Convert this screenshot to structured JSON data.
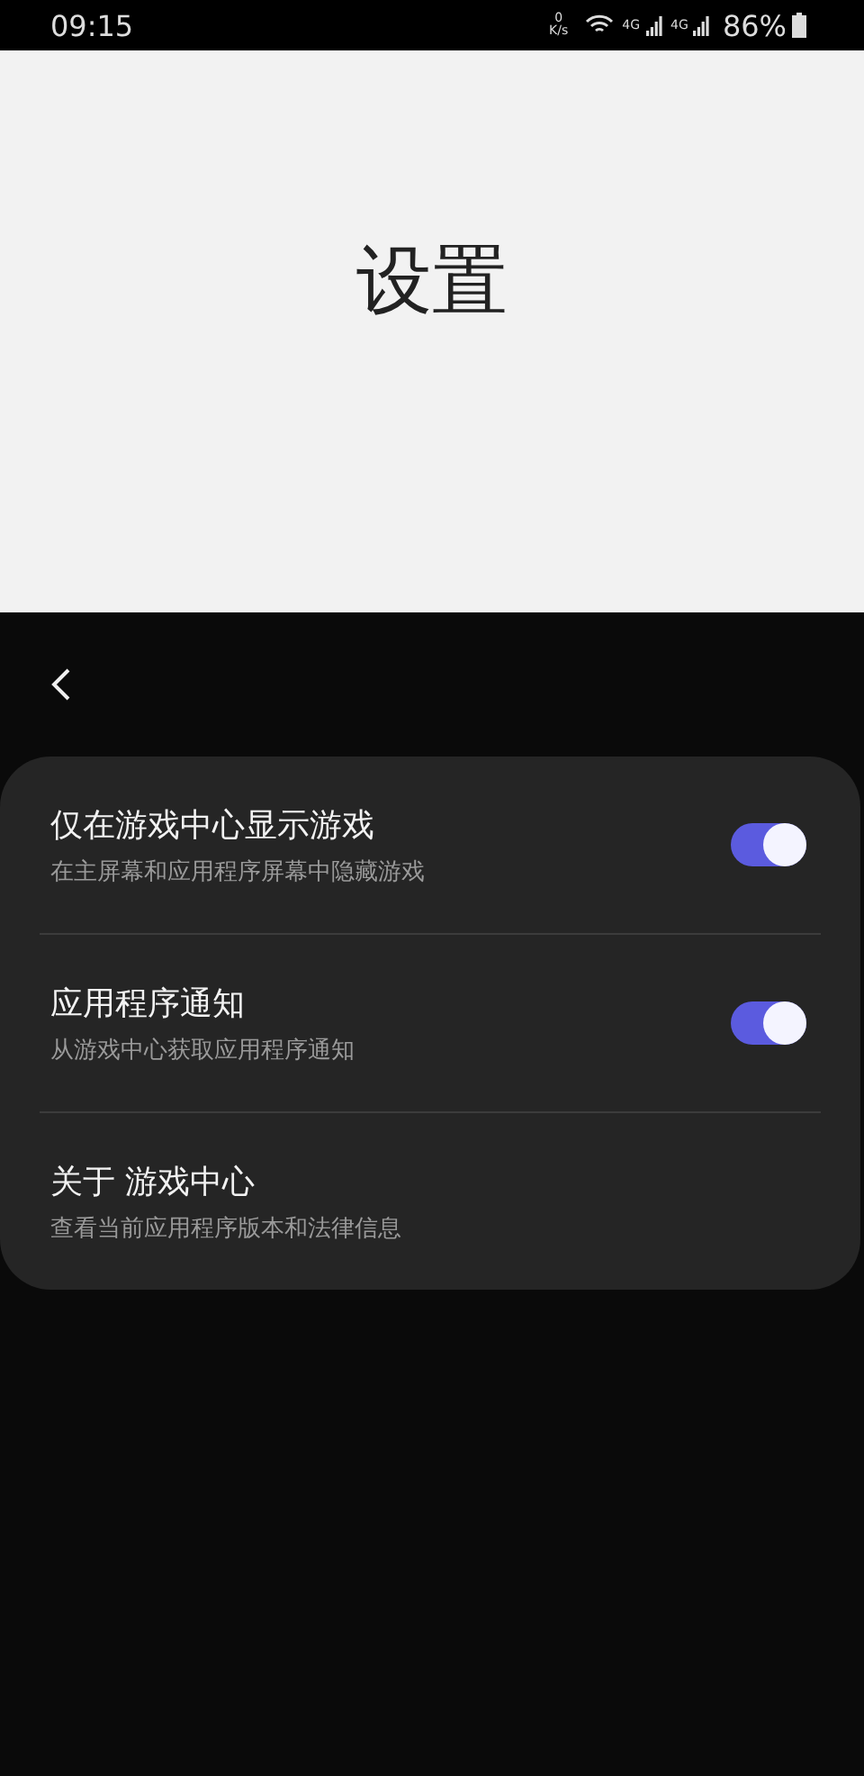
{
  "status_bar": {
    "time": "09:15",
    "speed_value": "0",
    "speed_unit": "K/s",
    "network_labels": [
      "4G",
      "4G"
    ],
    "battery": "86%"
  },
  "header": {
    "title": "设置"
  },
  "settings": [
    {
      "kind": "toggle",
      "title": "仅在游戏中心显示游戏",
      "subtitle": "在主屏幕和应用程序屏幕中隐藏游戏",
      "on": true
    },
    {
      "kind": "toggle",
      "title": "应用程序通知",
      "subtitle": "从游戏中心获取应用程序通知",
      "on": true
    },
    {
      "kind": "link",
      "title": "关于 游戏中心",
      "subtitle": "查看当前应用程序版本和法律信息"
    }
  ]
}
